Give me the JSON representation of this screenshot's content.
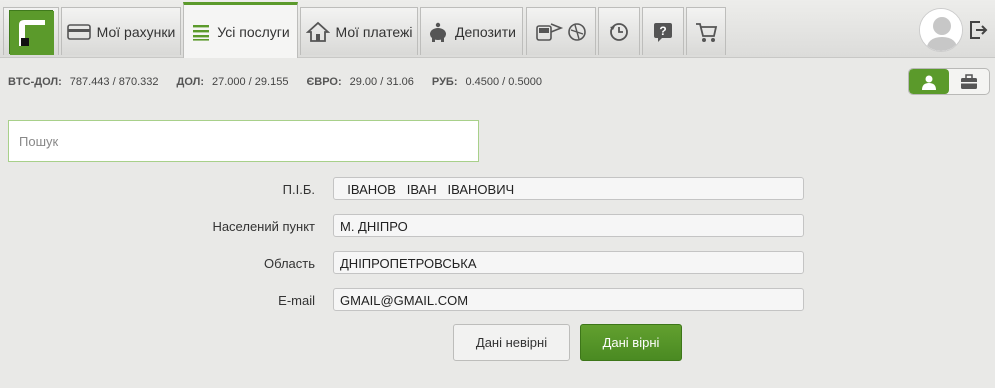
{
  "nav": {
    "tabs": [
      {
        "label": "",
        "icon": "privatbank-logo-icon"
      },
      {
        "label": "Мої рахунки",
        "icon": "card-icon"
      },
      {
        "label": "Усі послуги",
        "icon": "list-icon",
        "active": true
      },
      {
        "label": "Мої платежі",
        "icon": "house-icon"
      },
      {
        "label": "Депозити",
        "icon": "piggy-bank-icon"
      },
      {
        "label": "",
        "icon": "travel-icon"
      },
      {
        "label": "",
        "icon": "history-icon"
      },
      {
        "label": "",
        "icon": "help-icon"
      },
      {
        "label": "",
        "icon": "cart-icon"
      }
    ]
  },
  "rates": [
    {
      "name": "BTC-ДОЛ:",
      "value": "787.443 / 870.332"
    },
    {
      "name": "ДОЛ:",
      "value": "27.000 / 29.155"
    },
    {
      "name": "ЄВРО:",
      "value": "29.00 / 31.06"
    },
    {
      "name": "РУБ:",
      "value": "0.4500 / 0.5000"
    }
  ],
  "search": {
    "placeholder": "Пошук",
    "value": ""
  },
  "form": {
    "fields": [
      {
        "label": "П.І.Б.",
        "value": "  ІВАНОВ   ІВАН   ІВАНОВИЧ"
      },
      {
        "label": "Населений пункт",
        "value": "М. ДНІПРО"
      },
      {
        "label": "Область",
        "value": "ДНІПРОПЕТРОВСЬКА"
      },
      {
        "label": "E-mail",
        "value": "GMAIL@GMAIL.COM"
      }
    ],
    "wrong_label": "Дані невірні",
    "ok_label": "Дані вірні"
  },
  "colors": {
    "accent": "#5b9a2b"
  }
}
